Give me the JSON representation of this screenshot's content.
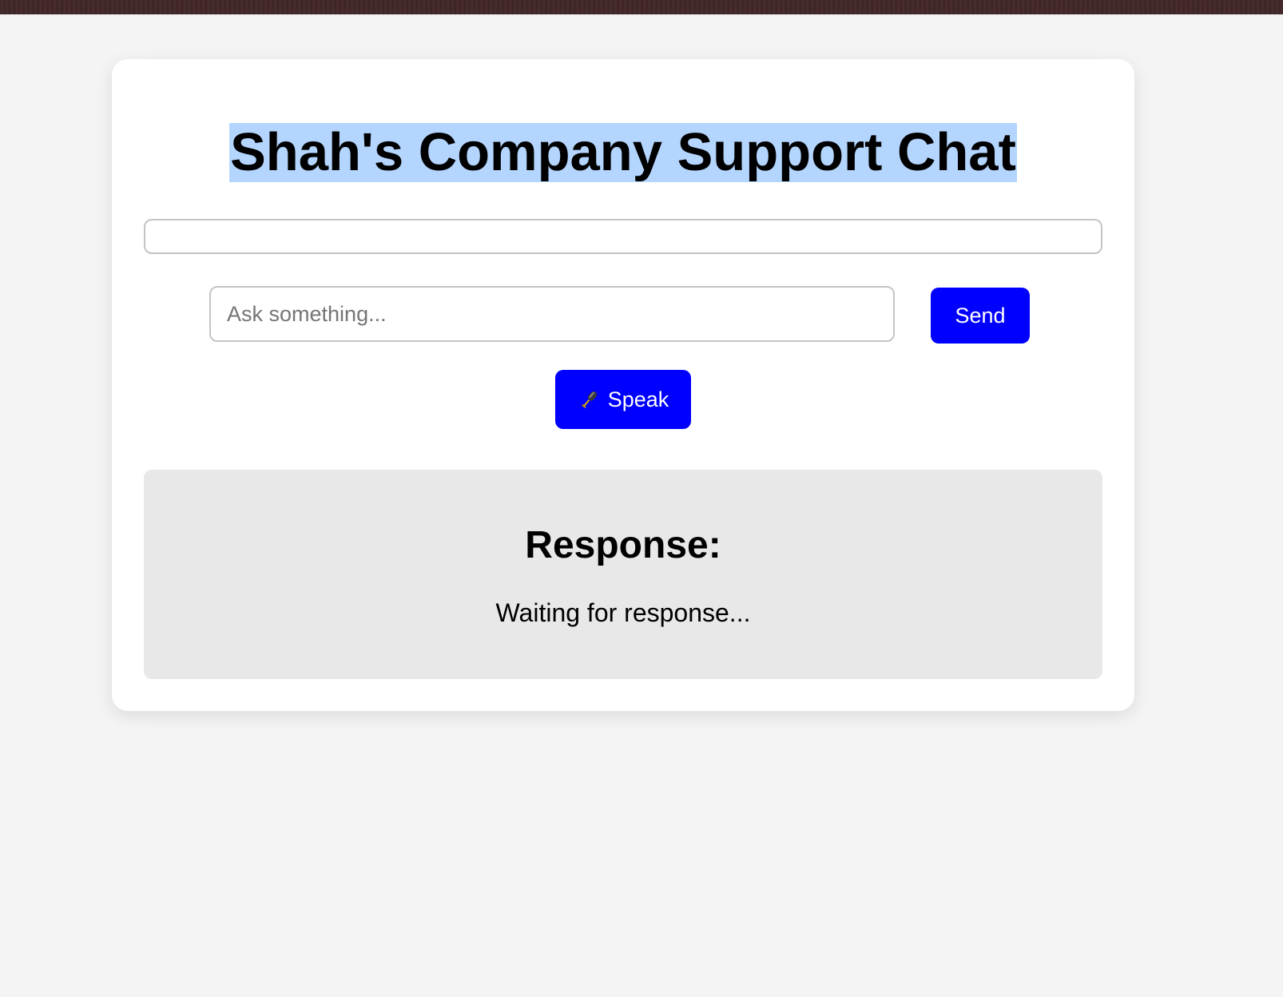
{
  "page": {
    "title": "Shah's Company Support Chat"
  },
  "chat_log": {
    "content": ""
  },
  "input": {
    "value": "",
    "placeholder": "Ask something..."
  },
  "buttons": {
    "send_label": "Send",
    "speak_label": "Speak",
    "speak_icon": "microphone-icon"
  },
  "response": {
    "heading": "Response:",
    "text": "Waiting for response..."
  },
  "colors": {
    "accent": "#0000ff",
    "page_background": "#f4f4f4",
    "card_background": "#ffffff",
    "response_background": "#e8e8e8",
    "title_highlight": "#b4d5fe",
    "top_strip": "#3e2526"
  }
}
